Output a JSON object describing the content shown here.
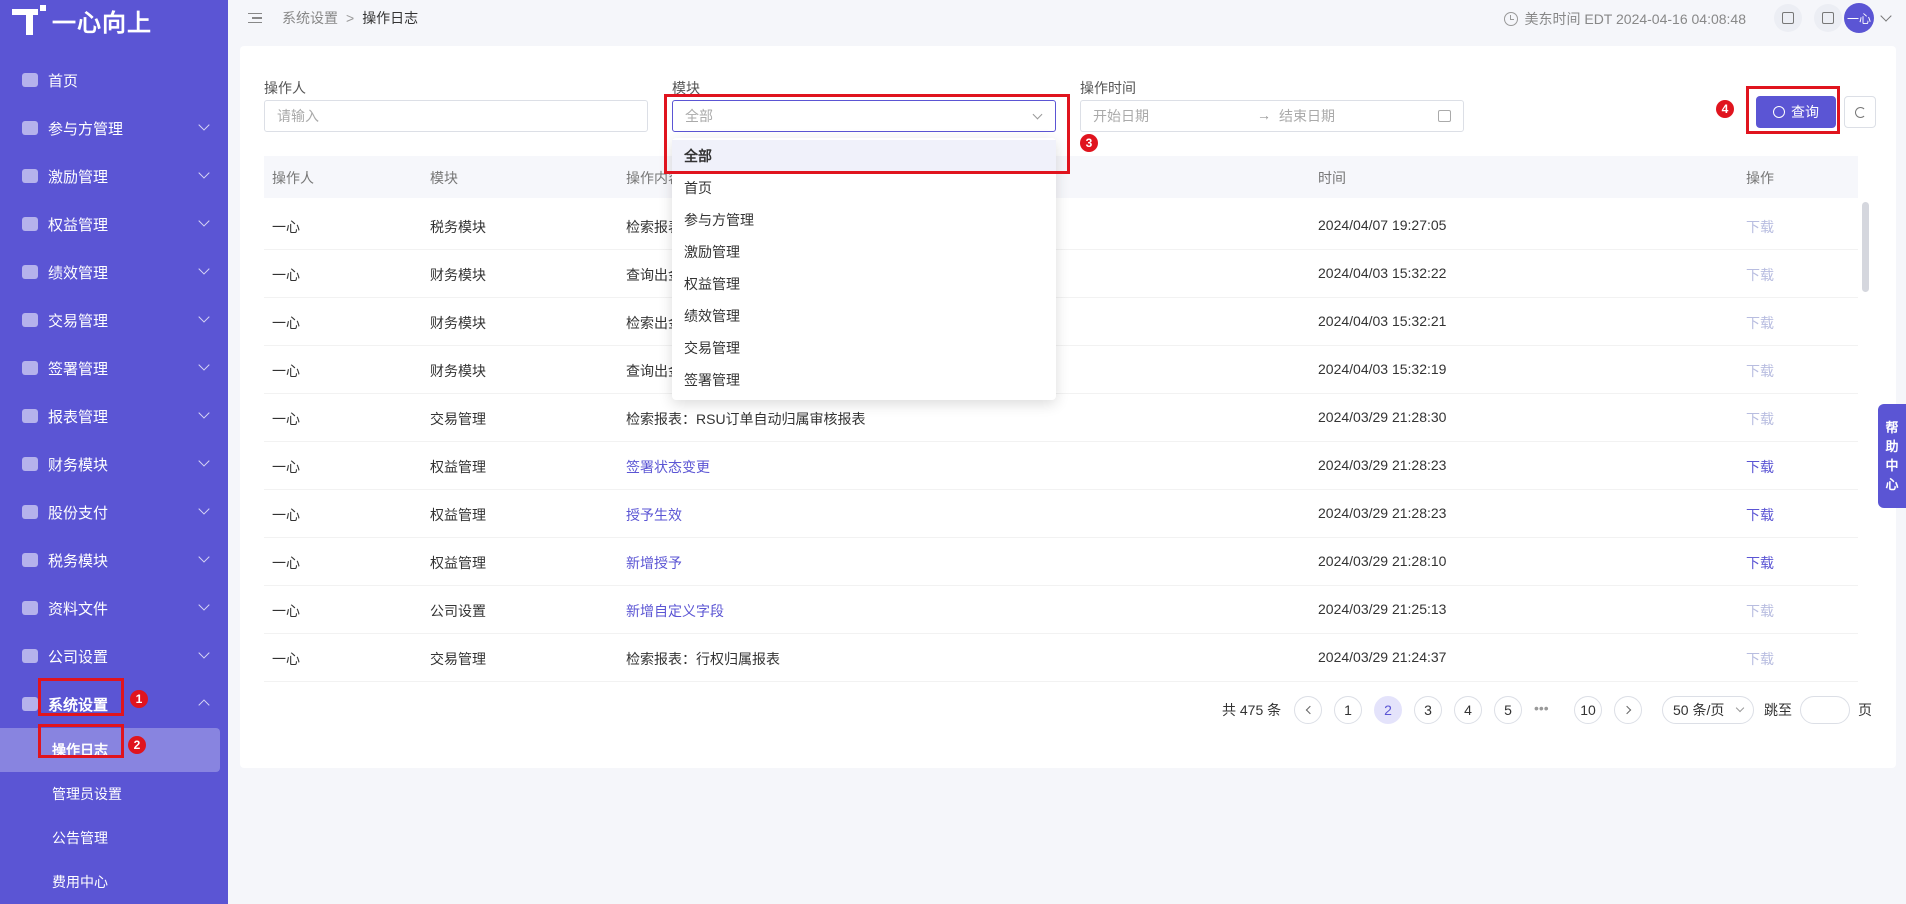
{
  "app": {
    "logo_text": "一心向上"
  },
  "sidebar": {
    "items": [
      {
        "label": "首页",
        "expandable": false
      },
      {
        "label": "参与方管理",
        "expandable": true
      },
      {
        "label": "激励管理",
        "expandable": true
      },
      {
        "label": "权益管理",
        "expandable": true
      },
      {
        "label": "绩效管理",
        "expandable": true
      },
      {
        "label": "交易管理",
        "expandable": true
      },
      {
        "label": "签署管理",
        "expandable": true
      },
      {
        "label": "报表管理",
        "expandable": true
      },
      {
        "label": "财务模块",
        "expandable": true
      },
      {
        "label": "股份支付",
        "expandable": true
      },
      {
        "label": "税务模块",
        "expandable": true
      },
      {
        "label": "资料文件",
        "expandable": true
      },
      {
        "label": "公司设置",
        "expandable": true
      },
      {
        "label": "系统设置",
        "expandable": true,
        "expanded": true
      }
    ],
    "sub_items": [
      {
        "label": "操作日志",
        "active": true
      },
      {
        "label": "管理员设置"
      },
      {
        "label": "公告管理"
      },
      {
        "label": "费用中心"
      }
    ]
  },
  "topbar": {
    "breadcrumb_parent": "系统设置",
    "breadcrumb_sep": ">",
    "breadcrumb_current": "操作日志",
    "time_text": "美东时间 EDT 2024-04-16 04:08:48",
    "avatar_text": "一心"
  },
  "filters": {
    "operator_label": "操作人",
    "operator_placeholder": "请输入",
    "module_label": "模块",
    "module_value": "全部",
    "time_label": "操作时间",
    "start_placeholder": "开始日期",
    "date_arrow": "→",
    "end_placeholder": "结束日期",
    "query_label": "查询"
  },
  "dropdown": {
    "options": [
      "全部",
      "首页",
      "参与方管理",
      "激励管理",
      "权益管理",
      "绩效管理",
      "交易管理",
      "签署管理"
    ],
    "selected": "全部"
  },
  "table": {
    "headers": [
      "操作人",
      "模块",
      "操作内容",
      "时间",
      "操作"
    ],
    "rows": [
      {
        "operator": "一心",
        "module": "税务模块",
        "content": "检索报表",
        "content_link": false,
        "time": "2024/04/07 19:27:05",
        "action": "下载",
        "action_enabled": false
      },
      {
        "operator": "一心",
        "module": "财务模块",
        "content": "查询出金",
        "content_link": false,
        "time": "2024/04/03 15:32:22",
        "action": "下载",
        "action_enabled": false
      },
      {
        "operator": "一心",
        "module": "财务模块",
        "content": "检索出金",
        "content_link": false,
        "time": "2024/04/03 15:32:21",
        "action": "下载",
        "action_enabled": false
      },
      {
        "operator": "一心",
        "module": "财务模块",
        "content": "查询出金",
        "content_link": false,
        "time": "2024/04/03 15:32:19",
        "action": "下载",
        "action_enabled": false
      },
      {
        "operator": "一心",
        "module": "交易管理",
        "content": "检索报表：RSU订单自动归属审核报表",
        "content_link": false,
        "time": "2024/03/29 21:28:30",
        "action": "下载",
        "action_enabled": false
      },
      {
        "operator": "一心",
        "module": "权益管理",
        "content": "签署状态变更",
        "content_link": true,
        "time": "2024/03/29 21:28:23",
        "action": "下载",
        "action_enabled": true
      },
      {
        "operator": "一心",
        "module": "权益管理",
        "content": "授予生效",
        "content_link": true,
        "time": "2024/03/29 21:28:23",
        "action": "下载",
        "action_enabled": true
      },
      {
        "operator": "一心",
        "module": "权益管理",
        "content": "新增授予",
        "content_link": true,
        "time": "2024/03/29 21:28:10",
        "action": "下载",
        "action_enabled": true
      },
      {
        "operator": "一心",
        "module": "公司设置",
        "content": "新增自定义字段",
        "content_link": true,
        "time": "2024/03/29 21:25:13",
        "action": "下载",
        "action_enabled": false
      },
      {
        "operator": "一心",
        "module": "交易管理",
        "content": "检索报表：行权归属报表",
        "content_link": false,
        "time": "2024/03/29 21:24:37",
        "action": "下载",
        "action_enabled": false
      }
    ]
  },
  "pagination": {
    "total_text": "共 475 条",
    "pages": [
      "1",
      "2",
      "3",
      "4",
      "5",
      "•••",
      "10"
    ],
    "current": "2",
    "page_size": "50 条/页",
    "jump_label": "跳至",
    "page_suffix": "页"
  },
  "help": {
    "label": "帮助中心",
    "chars": [
      "帮",
      "助",
      "中",
      "心"
    ]
  },
  "annotations": {
    "badges": [
      "1",
      "2",
      "3",
      "4"
    ]
  },
  "colors": {
    "accent": "#5b55d4",
    "annotation_red": "#e0141e"
  }
}
